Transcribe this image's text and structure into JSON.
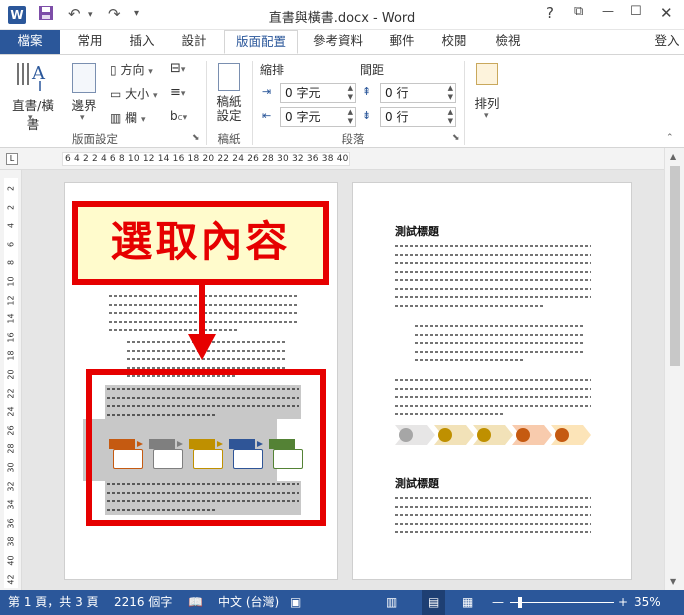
{
  "titlebar": {
    "app_icon": "W",
    "title": "直書與橫書.docx - Word",
    "help": "?",
    "restore": "⧉",
    "minimize": "—",
    "maximize": "☐",
    "close": "✕"
  },
  "tabs": [
    "檔案",
    "常用",
    "插入",
    "設計",
    "版面配置",
    "參考資料",
    "郵件",
    "校閱",
    "檢視"
  ],
  "account_label": "登入",
  "ribbon": {
    "text_direction": "直書/橫書",
    "margins": "邊界",
    "orientation": "方向",
    "size": "大小",
    "columns": "欄",
    "page_setup_group": "版面設定",
    "paper": "稿紙\n設定",
    "paper_group": "稿紙",
    "indent_label": "縮排",
    "spacing_label": "間距",
    "indent_left": "0 字元",
    "indent_right": "0 字元",
    "spacing_before": "0 行",
    "spacing_after": "0 行",
    "paragraph_group": "段落",
    "arrange": "排列"
  },
  "ruler": {
    "corner": "L",
    "marks": "6 4 2  2 4 6 8 10 12 14 16 18 20 22 24 26 28 30 32    36 38 40 42",
    "vertical_marks": [
      "2",
      "2",
      "4",
      "6",
      "8",
      "10",
      "12",
      "14",
      "16",
      "18",
      "20",
      "22",
      "24",
      "26",
      "28",
      "30",
      "32",
      "34",
      "36",
      "38",
      "40",
      "42"
    ]
  },
  "document": {
    "page2_heading_1": "測試標題",
    "page2_heading_2": "測試標題"
  },
  "callout": {
    "text": "選取內容"
  },
  "statusbar": {
    "page": "第 1 頁，共 3 頁",
    "words": "2216 個字",
    "language": "中文 (台灣)",
    "zoom": "35%"
  },
  "colors": {
    "accent": "#2b579a",
    "highlight": "#e60000",
    "callout_bg": "#fffbcc"
  }
}
